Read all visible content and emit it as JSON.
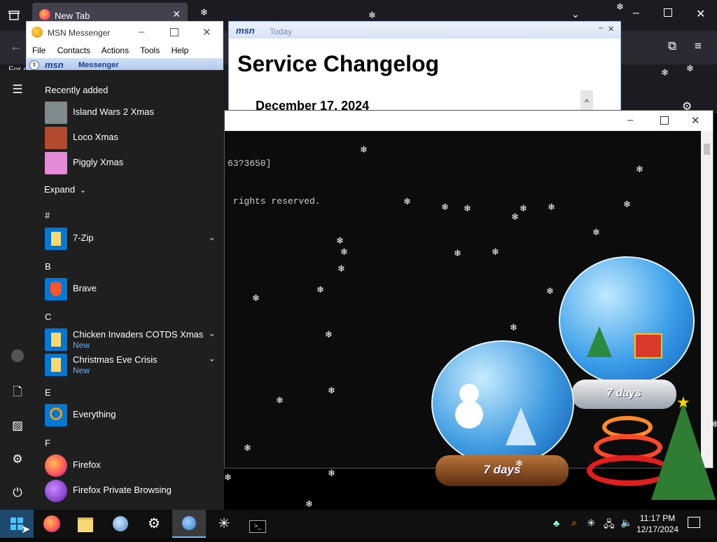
{
  "firefox": {
    "tab_title": "New Tab",
    "tab_close": "✕",
    "partial_text": "For c"
  },
  "msn": {
    "title": "MSN Messenger",
    "menus": [
      "File",
      "Contacts",
      "Actions",
      "Tools",
      "Help"
    ],
    "banner_logo": "msn",
    "banner_text": "Messenger"
  },
  "today": {
    "logo": "msn",
    "label": "Today",
    "heading": "Service Changelog",
    "date": "December 17, 2024"
  },
  "console": {
    "lines": [
      "63?3650]",
      " rights reserved."
    ]
  },
  "start_menu": {
    "recently_added_label": "Recently added",
    "recent": [
      {
        "label": "Island Wars 2 Xmas",
        "icon": "island-wars-icon",
        "color": "#8a8a8a"
      },
      {
        "label": "Loco Xmas",
        "icon": "loco-icon",
        "color": "#b34a2e"
      },
      {
        "label": "Piggly Xmas",
        "icon": "piggly-icon",
        "color": "#e58ad6"
      }
    ],
    "expand_label": "Expand",
    "sections": [
      {
        "letter": "#",
        "apps": [
          {
            "label": "7-Zip",
            "icon": "folder-icon",
            "expandable": true
          }
        ]
      },
      {
        "letter": "B",
        "apps": [
          {
            "label": "Brave",
            "icon": "brave-icon"
          }
        ]
      },
      {
        "letter": "C",
        "apps": [
          {
            "label": "Chicken Invaders COTDS Xmas",
            "badge": "New",
            "icon": "folder-icon",
            "expandable": true
          },
          {
            "label": "Christmas Eve Crisis",
            "badge": "New",
            "icon": "folder-icon",
            "expandable": true
          }
        ]
      },
      {
        "letter": "E",
        "apps": [
          {
            "label": "Everything",
            "icon": "everything-icon"
          }
        ]
      },
      {
        "letter": "F",
        "apps": [
          {
            "label": "Firefox",
            "icon": "firefox-icon"
          },
          {
            "label": "Firefox Private Browsing",
            "icon": "firefox-private-icon"
          }
        ]
      }
    ]
  },
  "globes": {
    "left_label": "7 days",
    "right_label": "7 days"
  },
  "taskbar": {
    "clock_time": "11:17 PM",
    "clock_date": "12/17/2024"
  },
  "colors": {
    "accent_blue": "#0078d4",
    "folder_yellow": "#f8d775",
    "start_bg": "#1f1f1f"
  }
}
